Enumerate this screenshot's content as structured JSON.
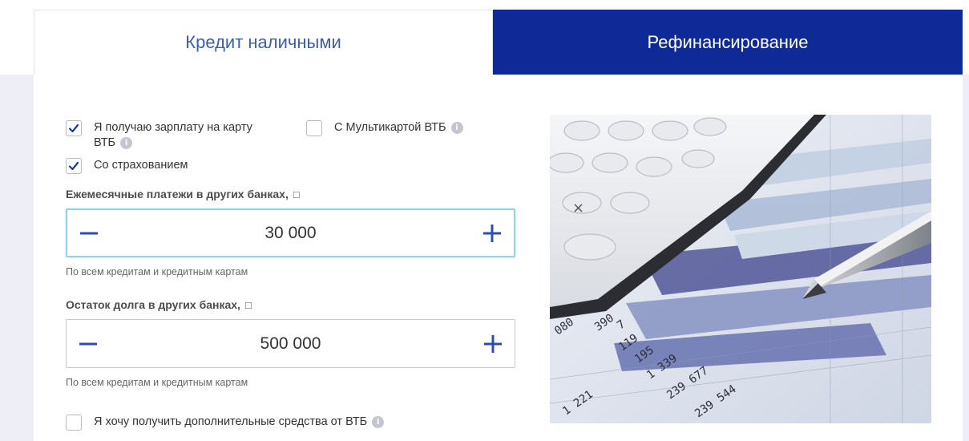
{
  "tabs": {
    "cash_credit": "Кредит наличными",
    "refinancing": "Рефинансирование"
  },
  "options": {
    "salary_card": {
      "label_line1": "Я получаю зарплату на карту",
      "label_line2": "ВТБ",
      "checked": true
    },
    "multicard": {
      "label": "С Мультикартой ВТБ",
      "checked": false
    },
    "insurance": {
      "label": "Со страхованием",
      "checked": true
    },
    "extra_funds": {
      "label": "Я хочу получить дополнительные средства от ВТБ",
      "checked": false
    }
  },
  "info_glyph": "i",
  "monthly_payments": {
    "label": "Ежемесячные платежи в других банках,",
    "currency_glyph": "□",
    "value": "30 000",
    "hint": "По всем кредитам и кредитным картам"
  },
  "debt_balance": {
    "label": "Остаток долга в других банках,",
    "currency_glyph": "□",
    "value": "500 000",
    "hint": "По всем кредитам и кредитным картам"
  },
  "photo": {
    "icon": "calculator-chart-pencil-photo",
    "printed_numbers": [
      "080",
      "390",
      "7",
      "119",
      "195",
      "1 339",
      "239 677",
      "239 544",
      "1 221"
    ]
  },
  "colors": {
    "active_tab": "#0f2a97",
    "inactive_tab_text": "#3f5ea3",
    "accent": "#2a4fad",
    "checkbox_check": "#1f3b8e",
    "focus_border": "#8fd2ee"
  }
}
